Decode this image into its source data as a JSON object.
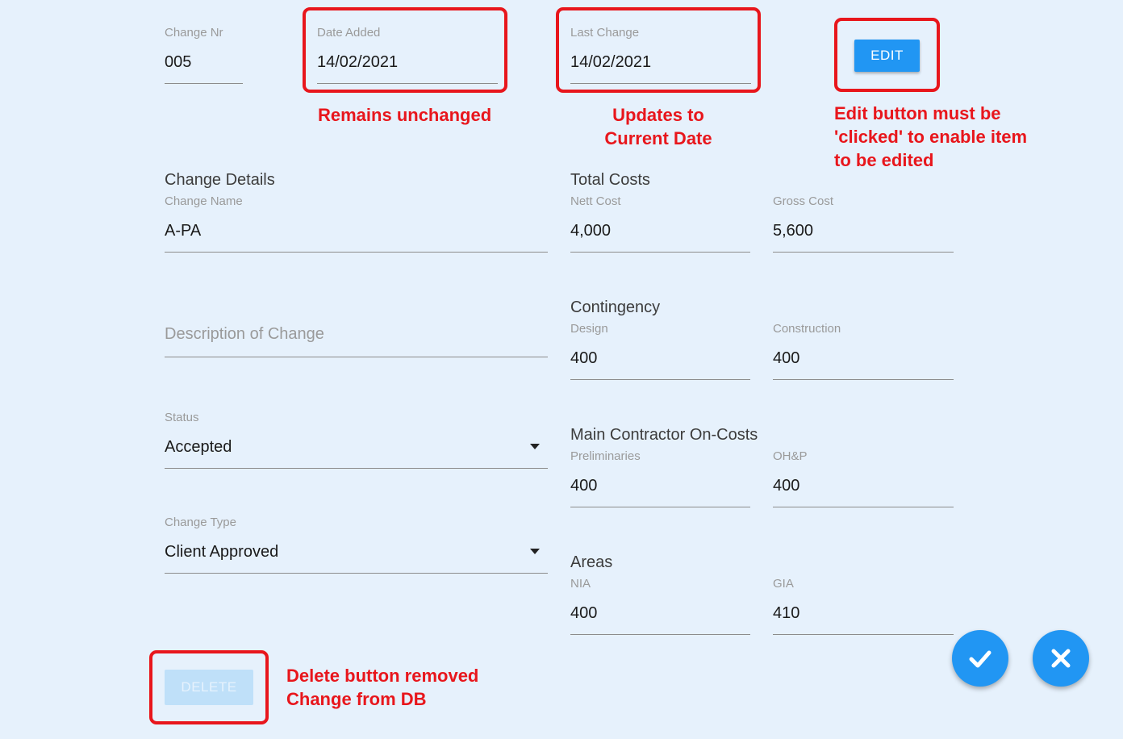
{
  "header": {
    "change_nr": {
      "label": "Change Nr",
      "value": "005"
    },
    "date_added": {
      "label": "Date Added",
      "value": "14/02/2021"
    },
    "last_change": {
      "label": "Last Change",
      "value": "14/02/2021"
    },
    "edit_label": "EDIT"
  },
  "annotations": {
    "date_added_note": "Remains unchanged",
    "last_change_note_line1": "Updates to",
    "last_change_note_line2": "Current Date",
    "edit_note_line1": "Edit button must be",
    "edit_note_line2": "'clicked' to enable item",
    "edit_note_line3": "to be edited",
    "delete_note_line1": "Delete button removed",
    "delete_note_line2": "Change from DB",
    "annotation_color": "#e8161c"
  },
  "change_details": {
    "title": "Change Details",
    "name_label": "Change Name",
    "name_value": "A-PA",
    "description_placeholder": "Description of Change",
    "status_label": "Status",
    "status_value": "Accepted",
    "type_label": "Change Type",
    "type_value": "Client Approved"
  },
  "total_costs": {
    "title": "Total Costs",
    "nett_label": "Nett Cost",
    "nett_value": "4,000",
    "gross_label": "Gross Cost",
    "gross_value": "5,600"
  },
  "contingency": {
    "title": "Contingency",
    "design_label": "Design",
    "design_value": "400",
    "construction_label": "Construction",
    "construction_value": "400"
  },
  "on_costs": {
    "title": "Main Contractor On-Costs",
    "prelim_label": "Preliminaries",
    "prelim_value": "400",
    "ohp_label": "OH&P",
    "ohp_value": "400"
  },
  "areas": {
    "title": "Areas",
    "nia_label": "NIA",
    "nia_value": "400",
    "gia_label": "GIA",
    "gia_value": "410"
  },
  "footer": {
    "delete_label": "DELETE",
    "confirm_icon": "check-icon",
    "cancel_icon": "close-icon"
  },
  "colors": {
    "background": "#e6f1fc",
    "accent": "#2196f3",
    "annotation": "#e8161c"
  }
}
